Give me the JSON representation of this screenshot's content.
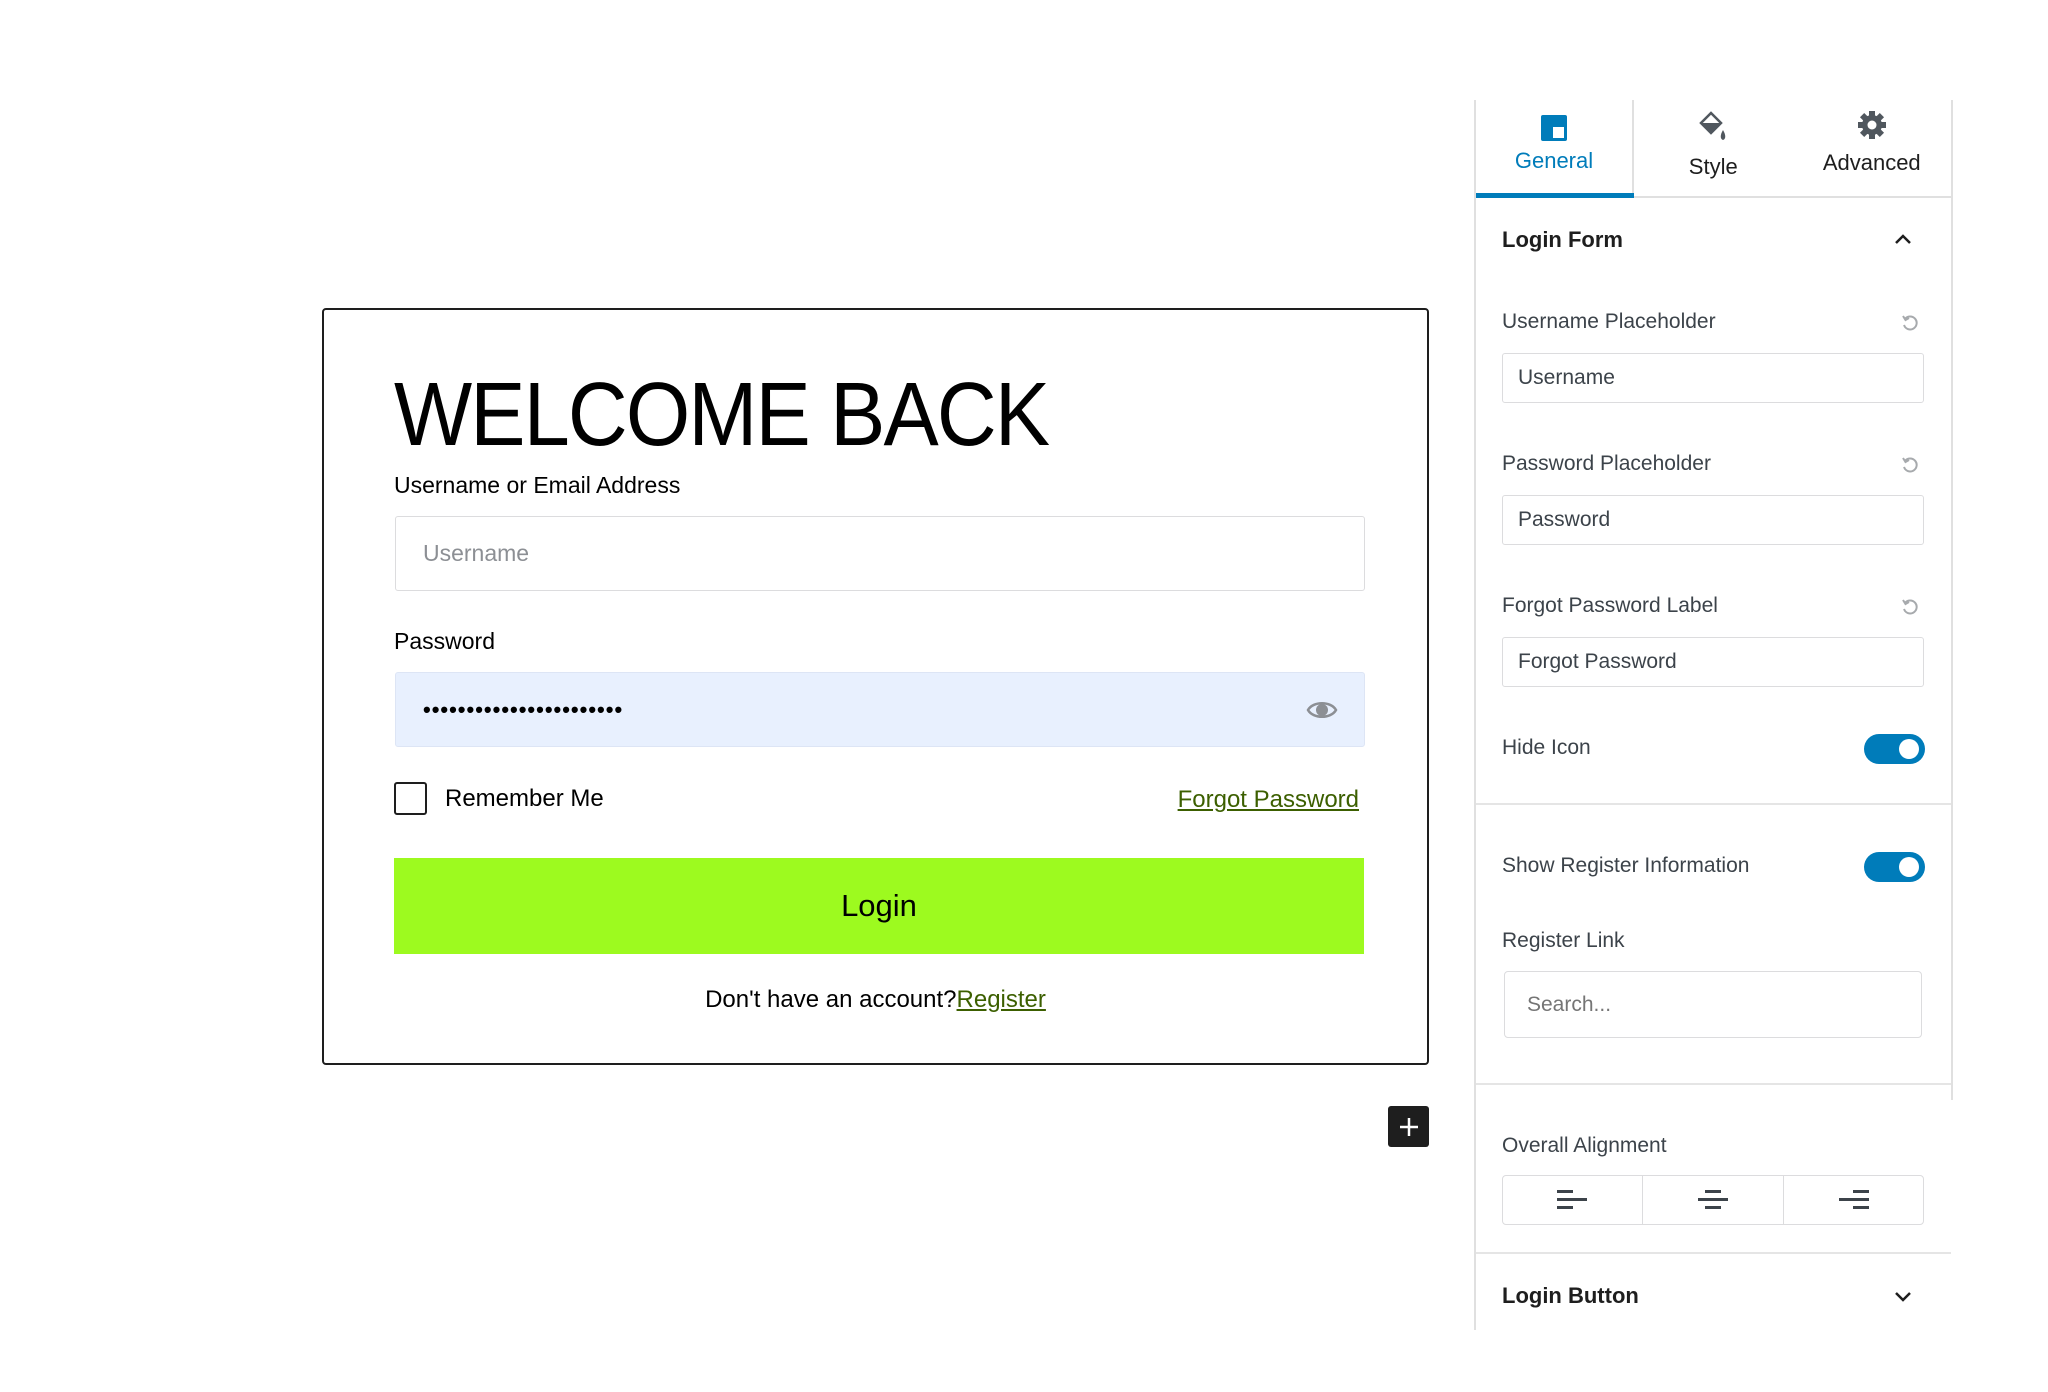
{
  "form": {
    "title": "WELCOME BACK",
    "username_label": "Username or Email Address",
    "username_placeholder": "Username",
    "password_label": "Password",
    "password_value_masked": "•••••••••••••••••••••••",
    "remember_label": "Remember Me",
    "remember_checked": false,
    "forgot_label": "Forgot Password",
    "login_label": "Login",
    "register_prompt": "Don't have an account?",
    "register_label": "Register",
    "colors": {
      "button": "#9dfa1f",
      "link": "#3c5f00",
      "password_bg": "#e8f0fe"
    }
  },
  "canvas": {
    "add_block_icon": "plus-icon"
  },
  "sidebar": {
    "tabs": [
      {
        "label": "General",
        "icon": "block-layout-icon",
        "active": true
      },
      {
        "label": "Style",
        "icon": "paint-bucket-icon",
        "active": false
      },
      {
        "label": "Advanced",
        "icon": "gear-icon",
        "active": false
      }
    ],
    "accent": "#007cba",
    "login_form_panel": {
      "title": "Login Form",
      "expanded": true,
      "username_placeholder_label": "Username Placeholder",
      "username_placeholder_value": "Username",
      "password_placeholder_label": "Password Placeholder",
      "password_placeholder_value": "Password",
      "forgot_label_label": "Forgot Password Label",
      "forgot_label_value": "Forgot Password",
      "hide_icon_label": "Hide Icon",
      "hide_icon_on": true,
      "show_register_label": "Show Register Information",
      "show_register_on": true,
      "register_link_label": "Register Link",
      "register_link_placeholder": "Search...",
      "alignment_label": "Overall Alignment",
      "alignment_options": [
        "left",
        "center",
        "right"
      ]
    },
    "login_button_panel": {
      "title": "Login Button",
      "expanded": false
    }
  }
}
